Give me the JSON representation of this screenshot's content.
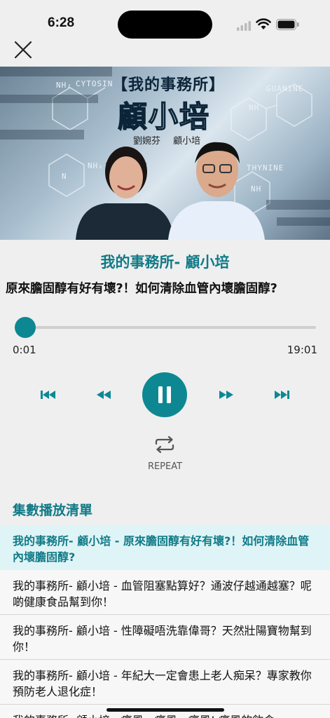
{
  "status_bar": {
    "time": "6:28"
  },
  "hero": {
    "banner_title": "【我的事務所】",
    "banner_name": "顧小培",
    "banner_hosts": "劉婉芬 顧小培",
    "chem_labels": [
      "CYTOSIN",
      "GUANINE",
      "THYNINE",
      "NH₂",
      "NH₂",
      "NH",
      "NH",
      "N"
    ]
  },
  "player": {
    "program_title": "我的事務所- 顧小培",
    "episode_title": "原來膽固醇有好有壞?！如何清除血管內壞膽固醇?",
    "elapsed": "0:01",
    "duration": "19:01",
    "progress_fraction": 0.002,
    "repeat_label": "REPEAT"
  },
  "playlist": {
    "heading": "集數播放清單",
    "items": [
      {
        "label": "我的事務所- 顧小培 - 原來膽固醇有好有壞?！如何清除血管內壞膽固醇?"
      },
      {
        "label": "我的事務所- 顧小培 - 血管阻塞點算好？通波仔越通越塞？呢啲健康食品幫到你！"
      },
      {
        "label": "我的事務所- 顧小培 - 性障礙唔洗靠偉哥？天然壯陽寶物幫到你！"
      },
      {
        "label": "我的事務所- 顧小培 - 年紀大一定會患上老人痴呆？專家教你預防老人退化症！"
      },
      {
        "label": "我的事務所- 顧小培 - 痛風、痛風、痛風! 痛風的飲食"
      }
    ]
  },
  "colors": {
    "accent": "#0d8893",
    "accent_text": "#107a87",
    "active_row": "#dff4f6"
  }
}
